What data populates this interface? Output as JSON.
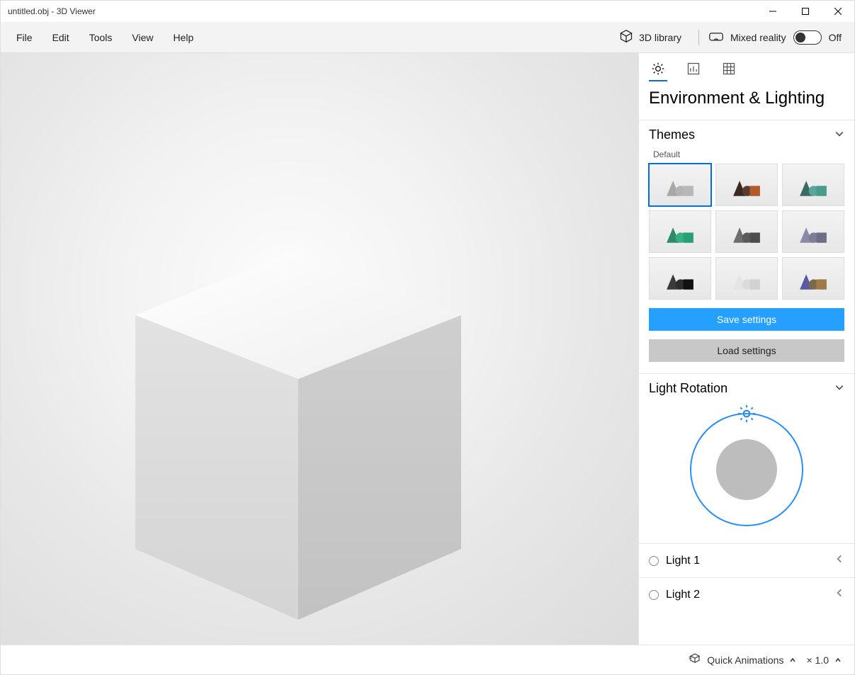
{
  "title": "untitled.obj - 3D Viewer",
  "menu": {
    "file": "File",
    "edit": "Edit",
    "tools": "Tools",
    "view": "View",
    "help": "Help",
    "library": "3D library",
    "mixed_reality": "Mixed reality",
    "mr_state": "Off"
  },
  "panel": {
    "heading": "Environment & Lighting",
    "themes": {
      "title": "Themes",
      "selected_label": "Default",
      "items": [
        {
          "cone": "#a8a8a8",
          "sphere": "#b4b4b4",
          "box": "#b8b8b8"
        },
        {
          "cone": "#3b2a22",
          "sphere": "#5a3c2e",
          "box": "#b35a2a"
        },
        {
          "cone": "#3a6a62",
          "sphere": "#5aa79a",
          "box": "#4a9c8a"
        },
        {
          "cone": "#2f8a6a",
          "sphere": "#34b083",
          "box": "#2aa071"
        },
        {
          "cone": "#6d6d6d",
          "sphere": "#5b5b5b",
          "box": "#4c4c4c"
        },
        {
          "cone": "#8a8aa6",
          "sphere": "#7d7d96",
          "box": "#6e6e88"
        },
        {
          "cone": "#3a3a3a",
          "sphere": "#2c2c2c",
          "box": "#111111"
        },
        {
          "cone": "#e5e5e5",
          "sphere": "#dcdcdc",
          "box": "#d2d2d2"
        },
        {
          "cone": "#5a5aa0",
          "sphere": "#7a6a4a",
          "box": "#a07a4a"
        }
      ]
    },
    "save_label": "Save settings",
    "load_label": "Load settings",
    "light_rotation": "Light Rotation",
    "light1": "Light 1",
    "light2": "Light 2"
  },
  "status": {
    "quick_anim": "Quick Animations",
    "scale": "× 1.0"
  }
}
